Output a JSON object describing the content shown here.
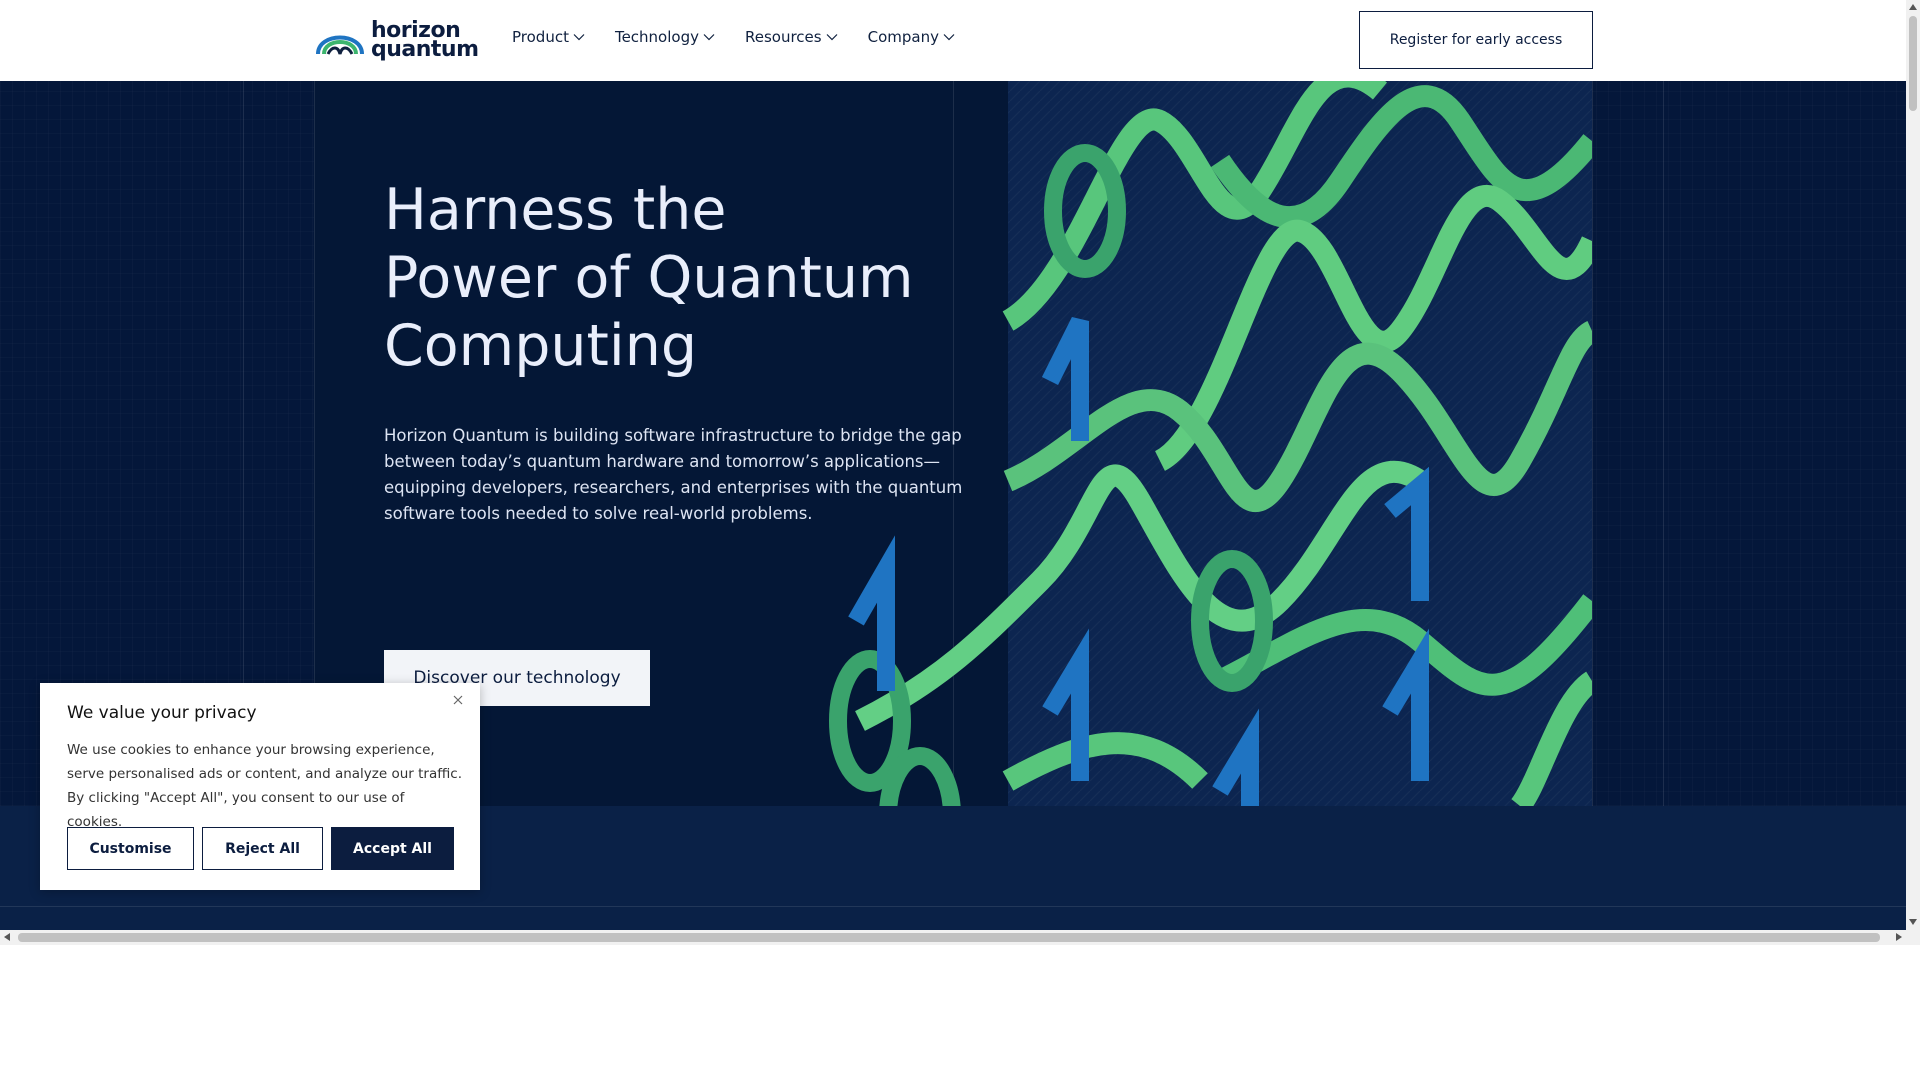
{
  "header": {
    "logo_line1": "horizon",
    "logo_line2": "quantum",
    "nav": [
      {
        "label": "Product"
      },
      {
        "label": "Technology"
      },
      {
        "label": "Resources"
      },
      {
        "label": "Company"
      }
    ],
    "register_label": "Register for early access"
  },
  "hero": {
    "title_lines": [
      "Harness the",
      "Power of Quantum",
      "Computing"
    ],
    "description": "Horizon Quantum is building software infrastructure to bridge the gap between today’s quantum hardware and tomorrow’s applications—equipping developers, researchers, and enterprises with the quantum software tools needed to solve real-world problems.",
    "cta_label": "Discover our technology"
  },
  "cookie": {
    "title": "We value your privacy",
    "text": "We use cookies to enhance your browsing experience, serve personalised ads or content, and analyze our traffic. By clicking \"Accept All\", you consent to our use of cookies.",
    "customise_label": "Customise",
    "reject_label": "Reject All",
    "accept_label": "Accept All"
  },
  "colors": {
    "navy": "#04173a",
    "green": "#6fd08c",
    "blue": "#1f74c2"
  }
}
